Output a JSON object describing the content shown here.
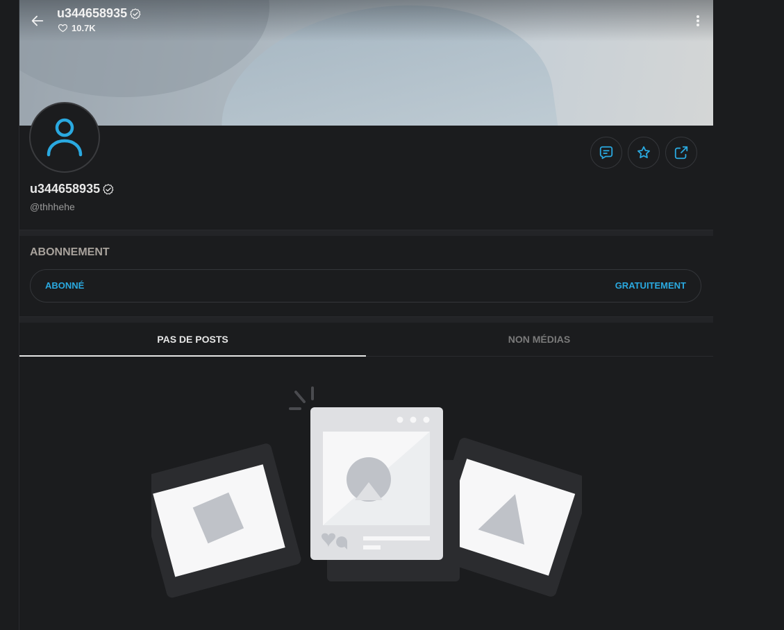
{
  "header": {
    "title": "u344658935",
    "likes": "10.7K"
  },
  "profile": {
    "name": "u344658935",
    "handle": "@thhhehe"
  },
  "subscription": {
    "title": "ABONNEMENT",
    "status_label": "ABONNÉ",
    "price_label": "GRATUITEMENT"
  },
  "tabs": [
    {
      "label": "PAS DE POSTS",
      "active": true
    },
    {
      "label": "NON MÉDIAS",
      "active": false
    }
  ],
  "colors": {
    "accent": "#2aa9e0",
    "background": "#1b1c1e"
  },
  "icons": {
    "back": "arrow-left-icon",
    "verified": "verified-badge-icon",
    "likes": "heart-icon",
    "more": "more-vertical-icon",
    "avatar": "user-icon",
    "message": "message-icon",
    "favorite": "star-icon",
    "share": "share-icon"
  }
}
